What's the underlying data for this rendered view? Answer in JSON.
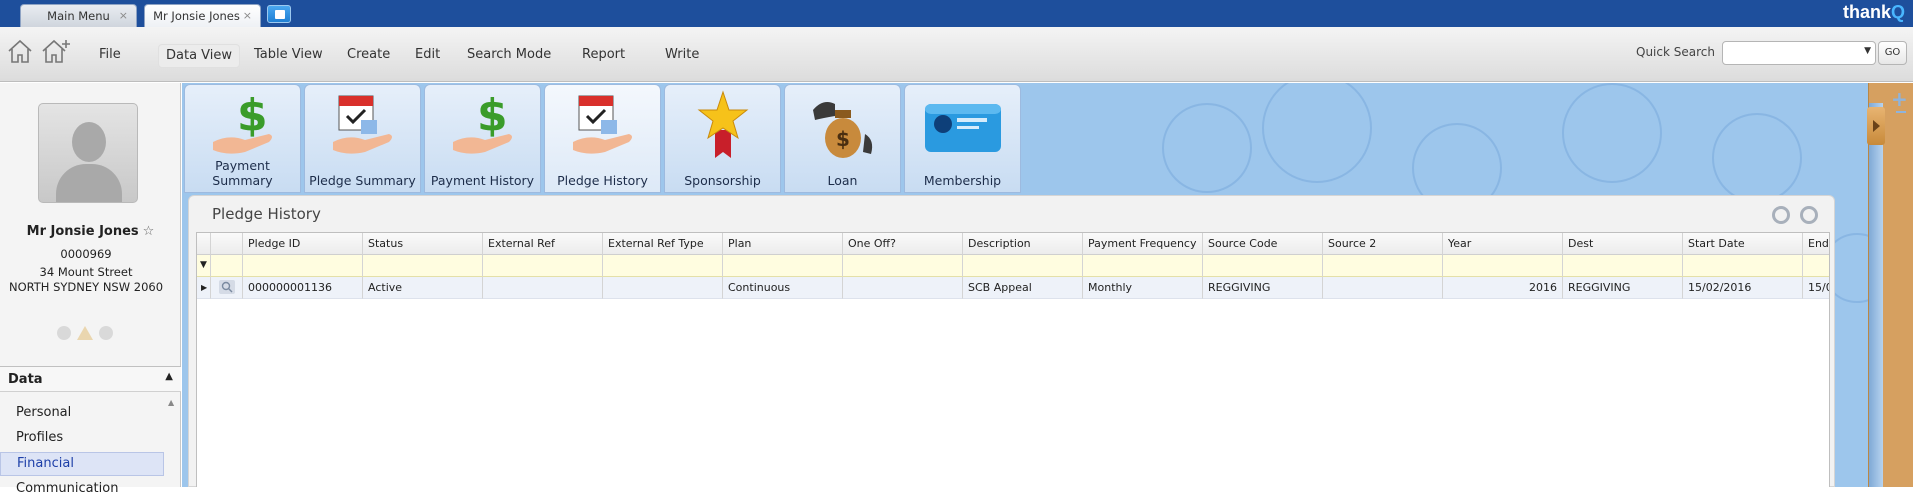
{
  "window": {
    "tabs": [
      {
        "label": "Main Menu",
        "close": "×"
      },
      {
        "label": "Mr Jonsie Jones",
        "close": "×"
      }
    ],
    "brand": {
      "text": "thank",
      "accent": "Q"
    }
  },
  "menubar": {
    "items": [
      "File",
      "Data View",
      "Table View",
      "Create",
      "Edit",
      "Search  Mode",
      "Report",
      "Write"
    ],
    "active": "Data View",
    "quick_search_label": "Quick Search",
    "quick_search_value": "",
    "go_label": "GO"
  },
  "contact": {
    "name": "Mr Jonsie Jones",
    "id": "0000969",
    "address_line1": "34 Mount Street",
    "address_line2": "NORTH SYDNEY NSW 2060"
  },
  "sidebar": {
    "section": "Data",
    "items": [
      "Personal",
      "Profiles",
      "Financial",
      "Communication"
    ],
    "active": "Financial"
  },
  "toolbar_tiles": [
    {
      "label": "Payment Summary",
      "icon": "payment-summary-icon"
    },
    {
      "label": "Pledge Summary",
      "icon": "pledge-summary-icon"
    },
    {
      "label": "Payment History",
      "icon": "payment-history-icon"
    },
    {
      "label": "Pledge History",
      "icon": "pledge-history-icon"
    },
    {
      "label": "Sponsorship",
      "icon": "sponsorship-icon"
    },
    {
      "label": "Loan",
      "icon": "loan-icon"
    },
    {
      "label": "Membership",
      "icon": "membership-icon"
    }
  ],
  "active_tile": "Pledge History",
  "panel": {
    "title": "Pledge History",
    "columns": [
      "Pledge ID",
      "Status",
      "External Ref",
      "External Ref Type",
      "Plan",
      "One Off?",
      "Description",
      "Payment Frequency",
      "Source Code",
      "Source 2",
      "Year",
      "Dest",
      "Start Date",
      "End"
    ],
    "rows": [
      [
        "000000001136",
        "Active",
        "",
        "",
        "Continuous",
        "",
        "SCB Appeal",
        "Monthly",
        "REGGIVING",
        "",
        "2016",
        "REGGIVING",
        "15/02/2016",
        "15/0"
      ]
    ]
  },
  "colors": {
    "topbar": "#1e4f9c",
    "main_bg": "#9dc6ec",
    "filter_row": "#fffde0",
    "active_nav": "#dde4f6"
  }
}
